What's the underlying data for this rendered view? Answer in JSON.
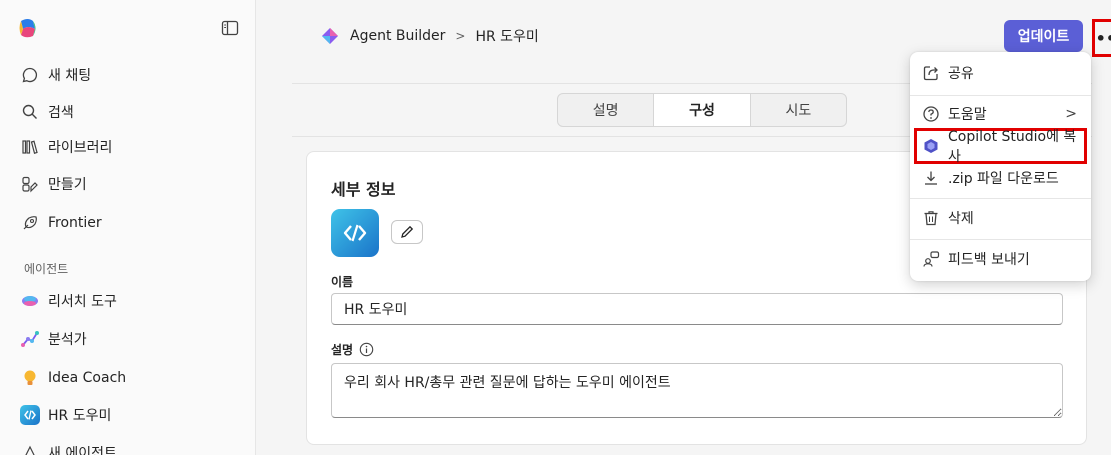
{
  "sidebar": {
    "nav": [
      {
        "label": "새 채팅",
        "icon": "chat-icon"
      },
      {
        "label": "검색",
        "icon": "search-icon"
      },
      {
        "label": "라이브러리",
        "icon": "library-icon"
      },
      {
        "label": "만들기",
        "icon": "create-icon"
      },
      {
        "label": "Frontier",
        "icon": "frontier-icon"
      }
    ],
    "section_label": "에이전트",
    "agents": [
      {
        "label": "리서치 도구",
        "icon": "research-icon"
      },
      {
        "label": "분석가",
        "icon": "analyst-icon"
      },
      {
        "label": "Idea Coach",
        "icon": "lightbulb-icon"
      },
      {
        "label": "HR 도우미",
        "icon": "code-agent-icon"
      },
      {
        "label": "새 에이전트",
        "icon": "new-agent-icon"
      }
    ]
  },
  "header": {
    "breadcrumb_root": "Agent Builder",
    "breadcrumb_current": "HR 도우미",
    "update_label": "업데이트",
    "more_label": "•••"
  },
  "tabs": [
    {
      "label": "설명",
      "active": false
    },
    {
      "label": "구성",
      "active": true
    },
    {
      "label": "시도",
      "active": false
    }
  ],
  "details": {
    "title": "세부 정보",
    "name_label": "이름",
    "name_value": "HR 도우미",
    "desc_label": "설명",
    "desc_value": "우리 회사 HR/총무 관련 질문에 답하는 도우미 에이전트"
  },
  "menu": {
    "items": [
      {
        "label": "공유",
        "icon": "share-icon"
      },
      {
        "label": "도움말",
        "icon": "help-icon"
      },
      {
        "label": "Copilot Studio에 복사",
        "icon": "copilot-studio-icon"
      },
      {
        "label": ".zip 파일 다운로드",
        "icon": "download-icon"
      },
      {
        "label": "삭제",
        "icon": "trash-icon"
      },
      {
        "label": "피드백 보내기",
        "icon": "feedback-icon"
      }
    ]
  },
  "colors": {
    "accent": "#5b5fd6",
    "highlight": "#e10000"
  }
}
